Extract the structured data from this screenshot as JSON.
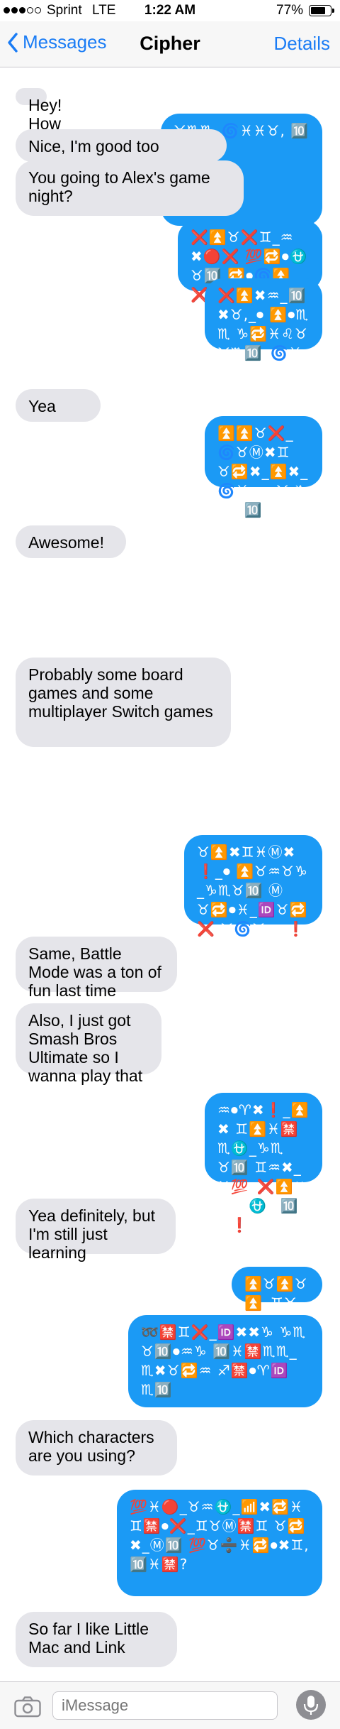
{
  "status": {
    "carrier": "Sprint",
    "network": "LTE",
    "time": "1:22 AM",
    "battery_text": "77%",
    "battery_level": 0.77
  },
  "nav": {
    "back_label": "Messages",
    "contact": "Cipher",
    "details_label": "Details",
    "back_icon": "chevron-left-icon"
  },
  "colors": {
    "accent": "#1a7cf5",
    "outgoing_bubble": "#1b9af5",
    "incoming_bubble": "#e5e5ea"
  },
  "messages": [
    {
      "from": "them",
      "text": "Hey! How are you?"
    },
    {
      "from": "me",
      "text": "⏫⏺❗"
    },
    {
      "from": "me",
      "text": "♉♏♏_🌀♓♓♉, 🔟♓🈲?"
    },
    {
      "from": "them",
      "text": "Nice, I'm good too"
    },
    {
      "from": "them",
      "text": "You going to Alex's game night?"
    },
    {
      "from": "me",
      "text": "❌⏫♉❌♊_♒✖🔴❌ 💯🔁⏺⛎♉🔟 🔁⏺🌀⏫❌?"
    },
    {
      "from": "them",
      "text": "Yea"
    },
    {
      "from": "me",
      "text": "❌⏫✖♒_🔟✖♉,_⏺ ⏫⏺♏♏ ♑🔁♓♌♉♉♏🔟_🌀♓"
    },
    {
      "from": "them",
      "text": "Awesome!"
    },
    {
      "from": "me",
      "text": "⏫⏫♉❌_🌀♉Ⓜ✖♊ ♉🔁✖_⏫✖_🌀♓♒♒♉ ♑♏♉🔟?"
    },
    {
      "from": "them",
      "text": "Probably some board games and some multiplayer Switch games"
    },
    {
      "from": "me",
      "text": "♉⏫✖♊♓Ⓜ✖❗_⏺ ⏫♉♒♉♑_♑♏♉🔟 Ⓜ♉🔁⏺♓_🆔♉🔁❌ ♉🌀♉⏺♒❗"
    },
    {
      "from": "them",
      "text": "Same, Battle Mode was a ton of fun last time"
    },
    {
      "from": "them",
      "text": "Also, I just got Smash Bros Ultimate so I wanna play that"
    },
    {
      "from": "me",
      "text": "♒⏺♈✖❗_⏫✖ ♊⏫♓🈲♏⛎_♑♏♉🔟 ♊♒✖_♓💯_❌⏫✖♊✖ ⛎♉🔟♊❗"
    },
    {
      "from": "them",
      "text": "Yea definitely, but I'm still just learning"
    },
    {
      "from": "me",
      "text": "⏫♉⏫♉⏫_♊♉Ⓜ✖"
    },
    {
      "from": "me",
      "text": "➿🈲♊❌_🆔✖✖♑ ♑♏♉🔟⏺♒♑ 🔟♓🈲♏♏_♏✖♉🔁♒ ♐🈲⏺♈🆔♏🔟"
    },
    {
      "from": "them",
      "text": "Which characters are you using?"
    },
    {
      "from": "me",
      "text": "💯♓🔴_♉♒⛎_📶✖🔁♓ ♊🈲⏺❌_♊♉Ⓜ🈲♊ ♉🔁✖_Ⓜ🔟 💯♉➗♓🔁⏺✖♊, 🔟♓🈲?"
    },
    {
      "from": "them",
      "text": "So far I like Little Mac and Link"
    }
  ],
  "composer": {
    "placeholder": "iMessage",
    "camera_icon": "camera-icon",
    "mic_icon": "microphone-icon"
  }
}
